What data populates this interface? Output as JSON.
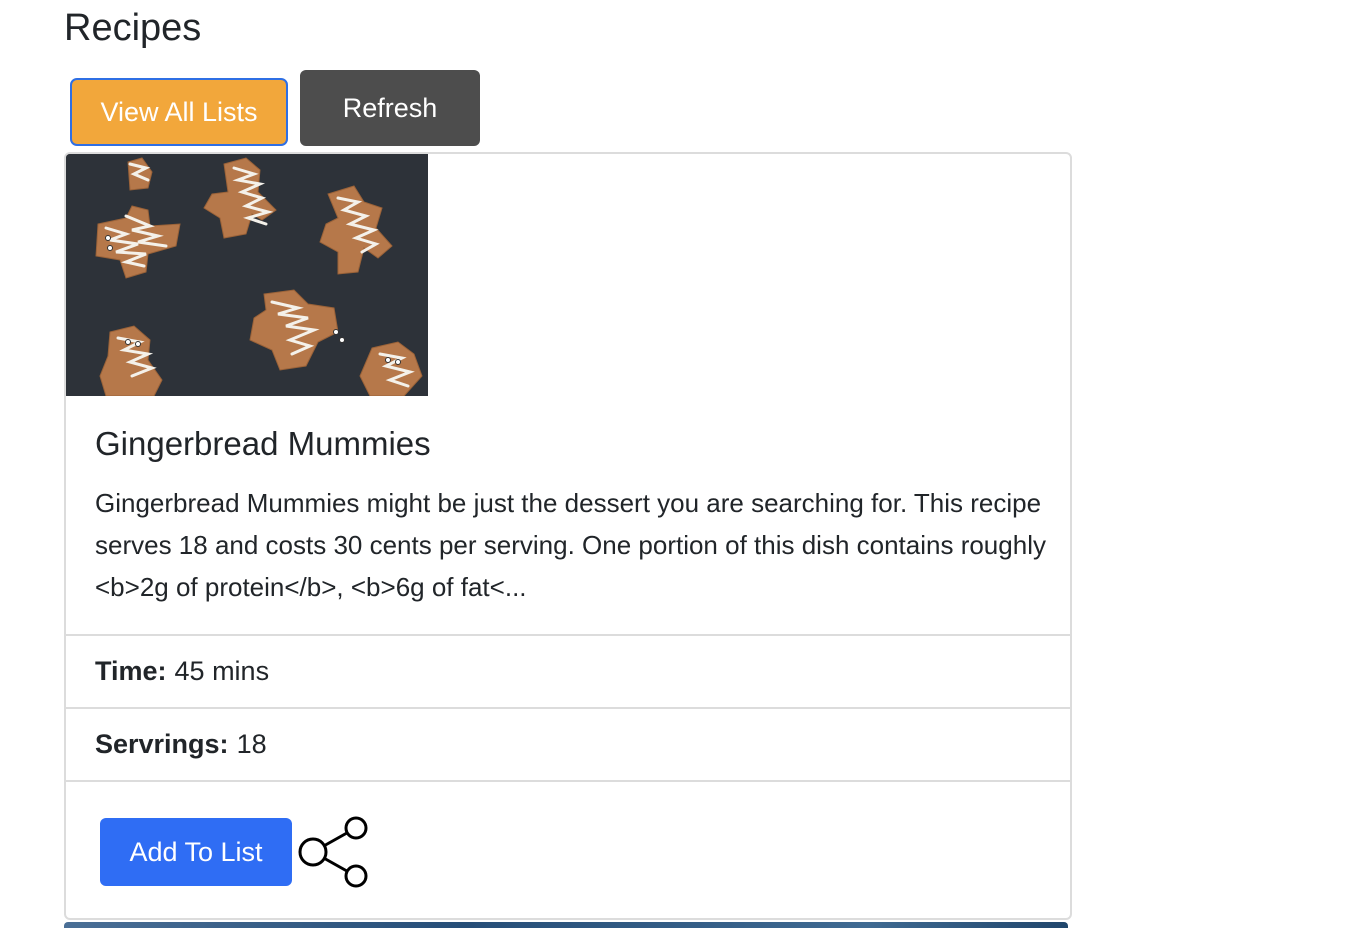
{
  "page": {
    "title": "Recipes"
  },
  "toolbar": {
    "view_all_lists_label": "View All Lists",
    "refresh_label": "Refresh"
  },
  "recipe": {
    "title": "Gingerbread Mummies",
    "description": "Gingerbread Mummies might be just the dessert you are searching for. This recipe serves 18 and costs 30 cents per serving. One portion of this dish contains roughly <b>2g of protein</b>, <b>6g of fat<...",
    "time_label": "Time:",
    "time_value": "45 mins",
    "servings_label": "Servrings:",
    "servings_value": "18",
    "add_to_list_label": "Add To List",
    "share_icon": "share-icon"
  },
  "colors": {
    "view_all_lists_bg": "#f2a73b",
    "refresh_bg": "#4d4d4d",
    "add_to_list_bg": "#2f6df4"
  }
}
